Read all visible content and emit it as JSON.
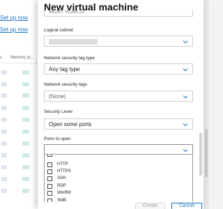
{
  "background": {
    "links": [
      "Set up now",
      "Set up now"
    ],
    "table_header": {
      "col1": "s",
      "col2": "Memory pr..."
    }
  },
  "dialog": {
    "title": "New virtual machine",
    "fields": [
      {
        "label": "Logical subnet",
        "value": "",
        "redacted": true
      },
      {
        "label": "Network security tag type",
        "value": "Any tag type"
      },
      {
        "label": "Network security tags",
        "value": "(None)",
        "placeholder": true
      },
      {
        "label": "Security Level",
        "value": "Open some ports"
      },
      {
        "label": "Ports to open",
        "value": ""
      }
    ],
    "ports_options": [
      "HTTP",
      "HTTPS",
      "SSH",
      "RDP",
      "WinRM",
      "SMB"
    ],
    "buttons": {
      "create": "Create",
      "cancel": "Cancel"
    }
  },
  "colors": {
    "accent": "#1a73c8",
    "border": "#cfcfcf"
  },
  "icons": {
    "dropdown": "chevron-down-icon",
    "checkbox": "checkbox-empty-icon"
  }
}
